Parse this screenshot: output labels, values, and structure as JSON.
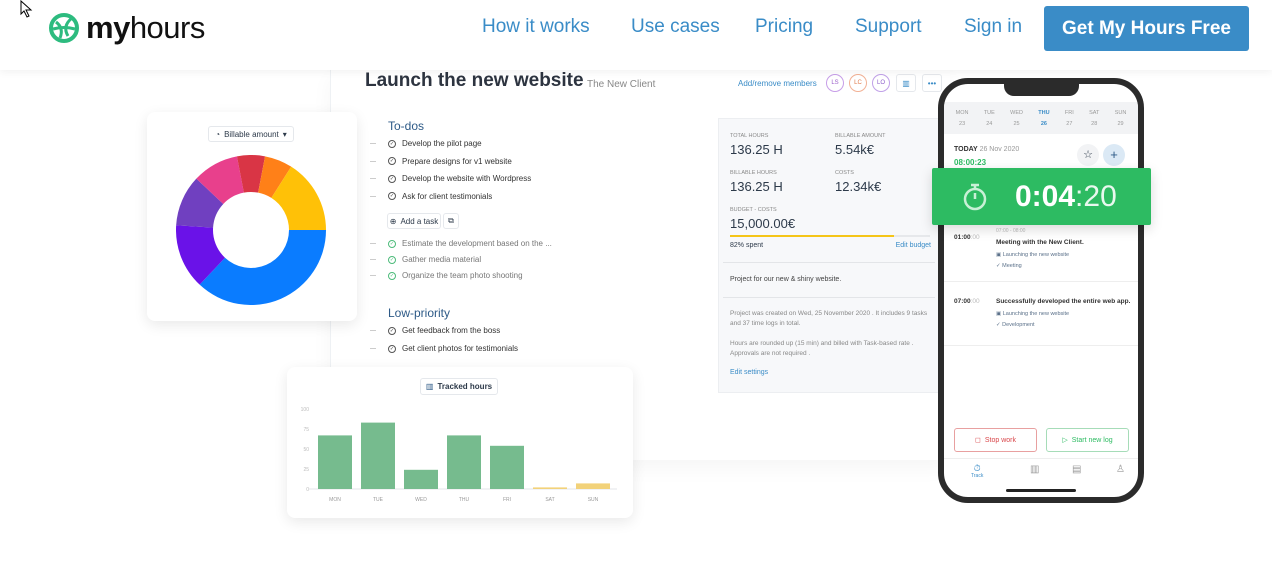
{
  "nav": {
    "logo": {
      "bold": "my",
      "light": "hours"
    },
    "links": [
      "How it works",
      "Use cases",
      "Pricing",
      "Support",
      "Sign in"
    ],
    "cta": "Get My Hours Free",
    "accent": "#3a8cc7"
  },
  "project": {
    "title": "Launch the new website",
    "client": "The New Client",
    "add_members": "Add/remove members",
    "members": [
      "LS",
      "LC",
      "LO"
    ],
    "todos": {
      "heading": "To-dos",
      "open": [
        "Develop the pilot page",
        "Prepare designs for v1 website",
        "Develop the website with Wordpress",
        "Ask for client testimonials"
      ],
      "add_task": "Add a task",
      "done": [
        "Estimate the development based on the ...",
        "Gather media material",
        "Organize the team photo shooting"
      ]
    },
    "low": {
      "heading": "Low-priority",
      "open": [
        "Get feedback from the boss",
        "Get client photos for testimonials"
      ]
    }
  },
  "stats": {
    "total_hours_label": "TOTAL HOURS",
    "total_hours": "136.25 H",
    "billable_amount_label": "BILLABLE AMOUNT",
    "billable_amount": "5.54k€",
    "billable_hours_label": "BILLABLE HOURS",
    "billable_hours": "136.25 H",
    "costs_label": "COSTS",
    "costs": "12.34k€",
    "budget_label": "BUDGET - COSTS",
    "budget": "15,000.00€",
    "spent_pct": 82,
    "spent": "82% spent",
    "edit_budget": "Edit budget",
    "description": "Project for our new & shiny website.",
    "created": "Project was created on Wed, 25 November 2020 . It includes 9 tasks and 37 time logs in total.",
    "rounding": "Hours are rounded up (15 min) and billed with Task-based rate . Approvals are not required .",
    "edit_settings": "Edit settings"
  },
  "donut": {
    "selector": "Billable amount",
    "slices": [
      {
        "value": 37,
        "color": "#0a7cff"
      },
      {
        "value": 14,
        "color": "#6a12e8"
      },
      {
        "value": 11,
        "color": "#7040c0"
      },
      {
        "value": 10,
        "color": "#e8408c"
      },
      {
        "value": 6,
        "color": "#d93545"
      },
      {
        "value": 6,
        "color": "#ff8018"
      },
      {
        "value": 16,
        "color": "#ffc107"
      }
    ]
  },
  "chart_data": {
    "type": "bar",
    "title": "Tracked hours",
    "categories": [
      "MON",
      "TUE",
      "WED",
      "THU",
      "FRI",
      "SAT",
      "SUN"
    ],
    "values": [
      67,
      83,
      24,
      67,
      54,
      2,
      7
    ],
    "colors": [
      "#76bb8e",
      "#76bb8e",
      "#76bb8e",
      "#76bb8e",
      "#76bb8e",
      "#f2d27a",
      "#f2d27a"
    ],
    "yticks": [
      0,
      25,
      50,
      75,
      100
    ],
    "ylim": [
      0,
      100
    ]
  },
  "phone": {
    "days": [
      {
        "d": "MON",
        "n": "23"
      },
      {
        "d": "TUE",
        "n": "24"
      },
      {
        "d": "WED",
        "n": "25"
      },
      {
        "d": "THU",
        "n": "26"
      },
      {
        "d": "FRI",
        "n": "27"
      },
      {
        "d": "SAT",
        "n": "28"
      },
      {
        "d": "SUN",
        "n": "29"
      }
    ],
    "today": "TODAY",
    "date": "26 Nov 2020",
    "today_total": "08:00:23",
    "timer": {
      "main": "0:04",
      "secs": ":20"
    },
    "logs": [
      {
        "dur": "01:00",
        "dur_s": ":00",
        "range": "07:00 - 08:00",
        "title": "Meeting with the New Client.",
        "project": "Launching the new website",
        "task": "Meeting"
      },
      {
        "dur": "07:00",
        "dur_s": ":00",
        "range": "",
        "title": "Successfully developed the entire web app.",
        "project": "Launching the new website",
        "task": "Development"
      }
    ],
    "stop": "Stop work",
    "start": "Start new log",
    "tab_track": "Track"
  }
}
